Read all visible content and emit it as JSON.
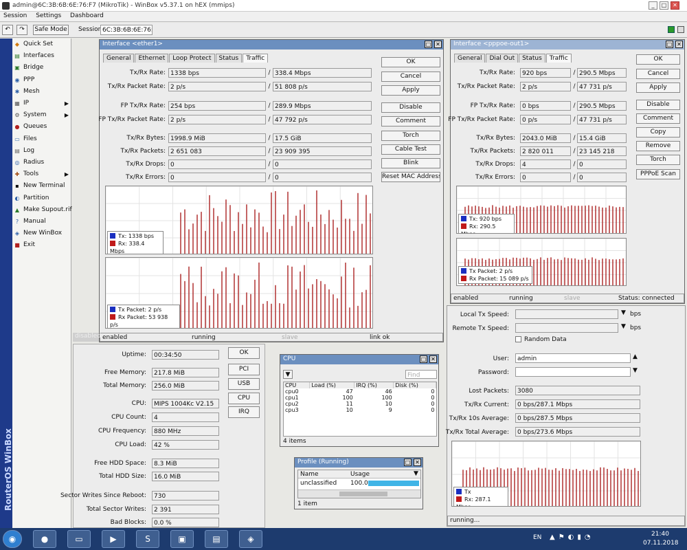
{
  "app": {
    "title": "admin@6C:3B:6B:6E:76:F7 (MikroTik) - WinBox v5.37.1 on hEX (mmips)",
    "menu": [
      "Session",
      "Settings",
      "Dashboard"
    ],
    "safe_mode": "Safe Mode",
    "session_label": "Session:",
    "session_value": "6C:3B:6B:6E:76:F7",
    "vertical_brand": "RouterOS WinBox"
  },
  "sidebar": {
    "items": [
      {
        "label": "Quick Set",
        "icon": "quick-set-icon",
        "glyph": "◆",
        "color": "#d07a10",
        "sub": false
      },
      {
        "label": "Interfaces",
        "icon": "interfaces-icon",
        "glyph": "▤",
        "color": "#2c7a2c",
        "sub": false
      },
      {
        "label": "Bridge",
        "icon": "bridge-icon",
        "glyph": "▣",
        "color": "#2c7a2c",
        "sub": false
      },
      {
        "label": "PPP",
        "icon": "ppp-icon",
        "glyph": "◉",
        "color": "#2c5fa8",
        "sub": false
      },
      {
        "label": "Mesh",
        "icon": "mesh-icon",
        "glyph": "✱",
        "color": "#2c5fa8",
        "sub": false
      },
      {
        "label": "IP",
        "icon": "ip-icon",
        "glyph": "▦",
        "color": "#555555",
        "sub": true
      },
      {
        "label": "System",
        "icon": "system-icon",
        "glyph": "⚙",
        "color": "#555555",
        "sub": true
      },
      {
        "label": "Queues",
        "icon": "queues-icon",
        "glyph": "●",
        "color": "#b02020",
        "sub": false
      },
      {
        "label": "Files",
        "icon": "files-icon",
        "glyph": "▭",
        "color": "#3a6fb0",
        "sub": false
      },
      {
        "label": "Log",
        "icon": "log-icon",
        "glyph": "▤",
        "color": "#666666",
        "sub": false
      },
      {
        "label": "Radius",
        "icon": "radius-icon",
        "glyph": "◎",
        "color": "#2c5fa8",
        "sub": false
      },
      {
        "label": "Tools",
        "icon": "tools-icon",
        "glyph": "✚",
        "color": "#a04a10",
        "sub": true
      },
      {
        "label": "New Terminal",
        "icon": "terminal-icon",
        "glyph": "▪",
        "color": "#111111",
        "sub": false
      },
      {
        "label": "Partition",
        "icon": "partition-icon",
        "glyph": "◐",
        "color": "#2c5fa8",
        "sub": false
      },
      {
        "label": "Make Supout.rif",
        "icon": "supout-icon",
        "glyph": "▲",
        "color": "#2c7a2c",
        "sub": false
      },
      {
        "label": "Manual",
        "icon": "manual-icon",
        "glyph": "?",
        "color": "#2c5fa8",
        "sub": false
      },
      {
        "label": "New WinBox",
        "icon": "winbox-icon",
        "glyph": "◈",
        "color": "#2c5fa8",
        "sub": false
      },
      {
        "label": "Exit",
        "icon": "exit-icon",
        "glyph": "■",
        "color": "#b02020",
        "sub": false
      }
    ]
  },
  "iface_win": {
    "title": "Interface <ether1>",
    "tabs": [
      "General",
      "Ethernet",
      "Loop Protect",
      "Status",
      "Traffic"
    ],
    "rows": [
      {
        "label": "Tx/Rx Rate:",
        "a": "1338 bps",
        "b": "338.4 Mbps"
      },
      {
        "label": "Tx/Rx Packet Rate:",
        "a": "2 p/s",
        "b": "51 808 p/s"
      },
      {
        "label": "FP Tx/Rx Rate:",
        "a": "254 bps",
        "b": "289.9 Mbps"
      },
      {
        "label": "FP Tx/Rx Packet Rate:",
        "a": "2 p/s",
        "b": "47 792 p/s"
      },
      {
        "label": "Tx/Rx Bytes:",
        "a": "1998.9 MiB",
        "b": "17.5 GiB"
      },
      {
        "label": "Tx/Rx Packets:",
        "a": "2 651 083",
        "b": "23 909 395"
      },
      {
        "label": "Tx/Rx Drops:",
        "a": "0",
        "b": "0"
      },
      {
        "label": "Tx/Rx Errors:",
        "a": "0",
        "b": "0"
      }
    ],
    "buttons": [
      "OK",
      "Cancel",
      "Apply",
      "Disable",
      "Comment",
      "Torch",
      "Cable Test",
      "Blink",
      "Reset MAC Address"
    ],
    "legend1": {
      "tx": "Tx: 1338 bps",
      "rx": "Rx: 338.4 Mbps"
    },
    "legend2": {
      "tx": "Tx Packet: 2 p/s",
      "rx": "Rx Packet: 53 938 p/s"
    },
    "status": {
      "s1": "enabled",
      "s2": "running",
      "s3": "slave",
      "s4": "link ok"
    },
    "side_status": "disabled"
  },
  "right_win": {
    "title": "Interface <pppoe-out1>",
    "tabs": [
      "General",
      "Dial Out",
      "Status",
      "Traffic"
    ],
    "rows": [
      {
        "label": "Tx/Rx Rate:",
        "a": "920 bps",
        "b": "290.5 Mbps"
      },
      {
        "label": "Tx/Rx Packet Rate:",
        "a": "2 p/s",
        "b": "47 731 p/s"
      },
      {
        "label": "FP Tx/Rx Rate:",
        "a": "0 bps",
        "b": "290.5 Mbps"
      },
      {
        "label": "FP Tx/Rx Packet Rate:",
        "a": "0 p/s",
        "b": "47 731 p/s"
      },
      {
        "label": "Tx/Rx Bytes:",
        "a": "2043.0 MiB",
        "b": "15.4 GiB"
      },
      {
        "label": "Tx/Rx Packets:",
        "a": "2 820 011",
        "b": "23 145 218"
      },
      {
        "label": "Tx/Rx Drops:",
        "a": "4",
        "b": "0"
      },
      {
        "label": "Tx/Rx Errors:",
        "a": "0",
        "b": "0"
      }
    ],
    "buttons": [
      "OK",
      "Cancel",
      "Apply",
      "Disable",
      "Comment",
      "Copy",
      "Remove",
      "Torch",
      "PPPoE Scan"
    ],
    "legend1": {
      "tx": "Tx: 920 bps",
      "rx": "Rx: 290.5 Mbps"
    },
    "legend2": {
      "tx": "Tx Packet: 2 p/s",
      "rx": "Rx Packet: 15 089 p/s"
    },
    "status": {
      "s1": "enabled",
      "s2": "running",
      "s3": "slave",
      "s4": "Status: connected"
    }
  },
  "bwtest": {
    "local_tx": "Local Tx Speed:",
    "remote_tx": "Remote Tx Speed:",
    "unit": "bps",
    "random": "Random Data",
    "user_label": "User:",
    "user_value": "admin",
    "password_label": "Password:",
    "lost_label": "Lost Packets:",
    "lost_value": "3080",
    "cur_label": "Tx/Rx Current:",
    "cur_value": "0 bps/287.1 Mbps",
    "avg10_label": "Tx/Rx 10s Average:",
    "avg10_value": "0 bps/287.5 Mbps",
    "avg_label": "Tx/Rx Total Average:",
    "avg_value": "0 bps/273.6 Mbps",
    "legend": {
      "tx": "Tx",
      "rx": "Rx: 287.1 Mbps"
    },
    "status": "running..."
  },
  "resources": {
    "rows": [
      {
        "label": "Uptime:",
        "value": "00:34:50"
      },
      {
        "label": "Free Memory:",
        "value": "217.8 MiB"
      },
      {
        "label": "Total Memory:",
        "value": "256.0 MiB"
      },
      {
        "label": "CPU:",
        "value": "MIPS 1004Kc V2.15"
      },
      {
        "label": "CPU Count:",
        "value": "4"
      },
      {
        "label": "CPU Frequency:",
        "value": "880 MHz"
      },
      {
        "label": "CPU Load:",
        "value": "42 %"
      },
      {
        "label": "Free HDD Space:",
        "value": "8.3 MiB"
      },
      {
        "label": "Total HDD Size:",
        "value": "16.0 MiB"
      },
      {
        "label": "Sector Writes Since Reboot:",
        "value": "730"
      },
      {
        "label": "Total Sector Writes:",
        "value": "2 391"
      },
      {
        "label": "Bad Blocks:",
        "value": "0.0 %"
      }
    ],
    "buttons": [
      "OK",
      "PCI",
      "USB",
      "CPU",
      "IRQ"
    ]
  },
  "cpu_win": {
    "title": "CPU",
    "find": "Find",
    "headers": [
      "CPU",
      "Load (%)",
      "IRQ (%)",
      "Disk (%)"
    ],
    "rows": [
      [
        "cpu0",
        "47",
        "46",
        "0"
      ],
      [
        "cpu1",
        "100",
        "100",
        "0"
      ],
      [
        "cpu2",
        "11",
        "10",
        "0"
      ],
      [
        "cpu3",
        "10",
        "9",
        "0"
      ]
    ],
    "count": "4 items"
  },
  "profile_win": {
    "title": "Profile (Running)",
    "headers": [
      "Name",
      "Usage"
    ],
    "row": {
      "name": "unclassified",
      "usage": "100.0",
      "fraction": 1.0
    },
    "count": "1 item"
  },
  "taskbar": {
    "lang": "EN",
    "time": "21:40",
    "date": "07.11.2018"
  },
  "colors": {
    "tx": "#1a2fc0",
    "rx": "#c01a1a",
    "title_active": "#6b8fbf",
    "taskbar": "#1d3b6e"
  }
}
